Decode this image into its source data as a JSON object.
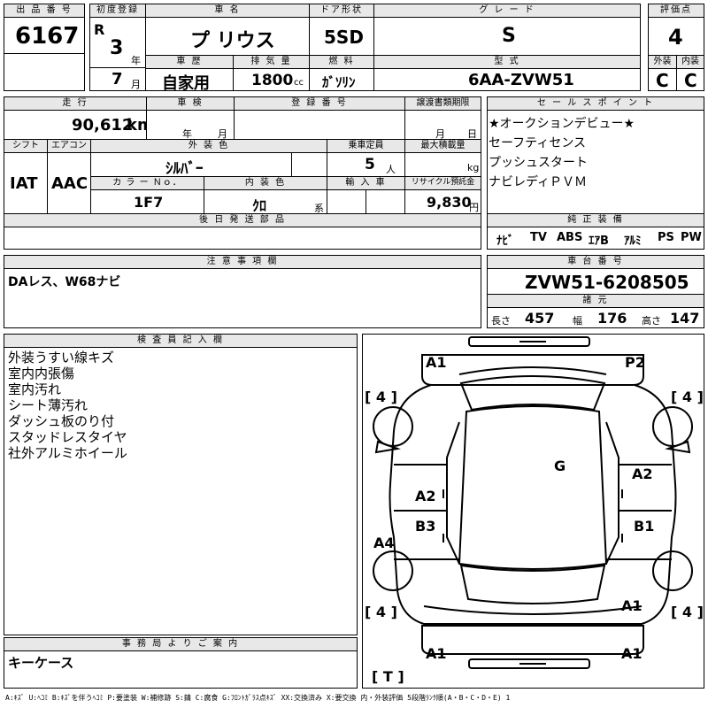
{
  "header": {
    "lot_no_label": "出 品 番 号",
    "lot_no": "6167",
    "first_reg_label": "初度登録",
    "era": "R",
    "reg_year": "3",
    "year_unit": "年",
    "reg_month": "7",
    "month_unit": "月",
    "car_name_label": "車 名",
    "car_name": "プ リウス",
    "door_label": "ドア形状",
    "door": "5SD",
    "grade_label": "グ レ ー ド",
    "grade": "S",
    "score_label": "評価点",
    "score": "4",
    "history_label": "車 歴",
    "history": "自家用",
    "displacement_label": "排 気 量",
    "displacement": "1800",
    "displacement_unit": "cc",
    "fuel_label": "燃 料",
    "fuel": "ｶﾞｿﾘﾝ",
    "model_label": "型 式",
    "model": "6AA-ZVW51",
    "exterior_label": "外装",
    "exterior_grade": "C",
    "interior_label": "内装",
    "interior_grade": "C"
  },
  "row2": {
    "mileage_label": "走 行",
    "mileage": "90,612",
    "mileage_unit": "km",
    "inspection_label": "車 検",
    "insp_year_unit": "年",
    "insp_month_unit": "月",
    "plate_label": "登 録 番 号",
    "transfer_label": "譲渡書類期限",
    "transfer_month_unit": "月",
    "transfer_day_unit": "日",
    "shift_label": "シフト",
    "shift": "IAT",
    "ac_label": "エアコン",
    "ac": "AAC",
    "color_label": "外 装 色",
    "color": "ｼﾙﾊﾞｰ",
    "capacity_label": "乗車定員",
    "capacity": "5",
    "capacity_unit": "人",
    "load_label": "最大積載量",
    "load_unit": "kg",
    "color_no_label": "カ ラ ー Ｎｏ．",
    "color_no": "1F7",
    "interior_color_label": "内 装 色",
    "interior_color": "ｸﾛ",
    "interior_color_unit": "系",
    "import_label": "輸 入 車",
    "recycle_label": "リサイクル預託金",
    "recycle": "9,830",
    "recycle_unit": "円",
    "later_parts_label": "後 日 発 送 部 品"
  },
  "sales_points": {
    "label": "セ ー ル ス ポ イ ン ト",
    "items": [
      "★オークションデビュー★",
      "セーフティセンス",
      "プッシュスタート",
      "ナビレディＰＶＭ"
    ]
  },
  "equipment": {
    "label": "純 正 装 備",
    "items": [
      "ﾅﾋﾞ",
      "TV",
      "ABS",
      "ｴｱB",
      "ｱﾙﾐ",
      "PS",
      "PW"
    ]
  },
  "notes": {
    "label": "注 意 事 項 欄",
    "text": "DAレス、W68ナビ"
  },
  "chassis": {
    "label": "車 台 番 号",
    "number": "ZVW51-6208505",
    "spec_label": "諸 元",
    "length_label": "長さ",
    "length": "457",
    "width_label": "幅",
    "width": "176",
    "height_label": "高さ",
    "height": "147"
  },
  "inspector": {
    "label": "検 査 員 記 入 欄",
    "lines": [
      "外装うすい線キズ",
      "室内内張傷",
      "室内汚れ",
      "シート薄汚れ",
      "ダッシュ板のり付",
      "スタッドレスタイヤ",
      "社外アルミホイール"
    ]
  },
  "office": {
    "label": "事 務 局 よ り ご 案 内",
    "text": "キーケース"
  },
  "diagram": {
    "marks": {
      "front_left": "A1",
      "front_right": "P2",
      "tire_fl": "[ 4 ]",
      "tire_fr": "[ 4 ]",
      "roof": "G",
      "left_front_door": "A2",
      "right_front_door": "A2",
      "left_rear_door": "B3",
      "right_rear_door": "B1",
      "left_rear_fender": "A4",
      "right_rear_quarter": "A1",
      "tire_rl": "[ 4 ]",
      "tire_rr": "[ 4 ]",
      "rear_bumper_left": "A1",
      "rear_bumper_right": "A1",
      "spare_tire": "[ T ]"
    }
  },
  "legend": "A:ｷｽﾞ U:ﾍｺﾐ B:ｷｽﾞを伴うﾍｺﾐ P:要塗装 W:補修跡 S:錆 C:腐食 G:ﾌﾛﾝﾄｶﾞﾗｽ点ｷｽﾞ XX:交換済み X:要交換 内・外装評価 5段階ﾗﾝｸ順(A・B・C・D・E) 1"
}
